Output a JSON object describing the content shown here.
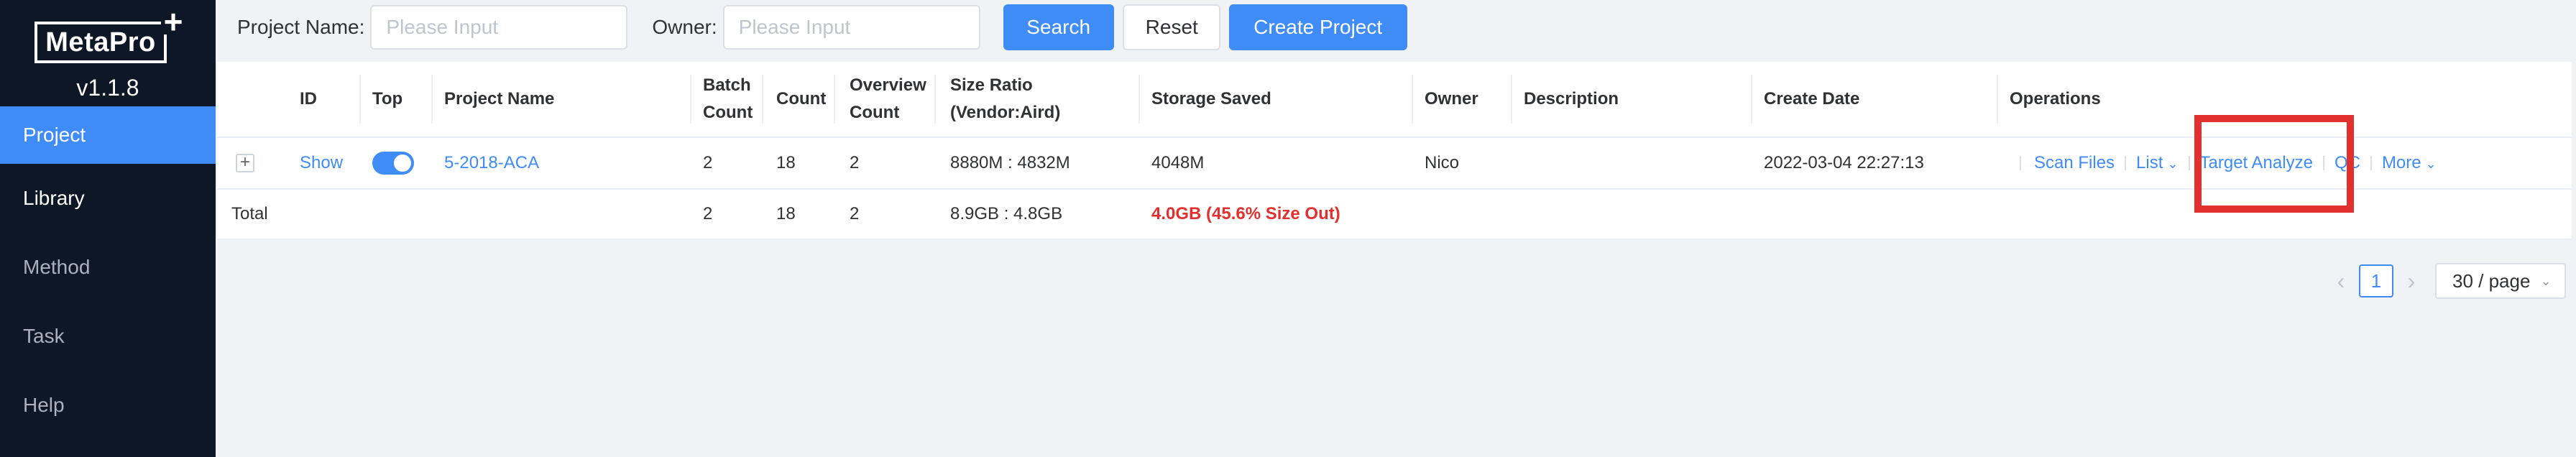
{
  "sidebar": {
    "logo": "MetaPro",
    "logo_plus": "+",
    "version": "v1.1.8",
    "items": [
      {
        "label": "Project"
      },
      {
        "label": "Library"
      },
      {
        "label": "Method"
      },
      {
        "label": "Task"
      },
      {
        "label": "Help"
      }
    ]
  },
  "search": {
    "project_name_label": "Project Name:",
    "project_name_placeholder": "Please Input",
    "owner_label": "Owner:",
    "owner_placeholder": "Please Input",
    "search_btn": "Search",
    "reset_btn": "Reset",
    "create_btn": "Create Project"
  },
  "table": {
    "headers": {
      "id": "ID",
      "top": "Top",
      "project_name": "Project Name",
      "batch_count_1": "Batch",
      "batch_count_2": "Count",
      "count": "Count",
      "overview_1": "Overview",
      "overview_2": "Count",
      "size_ratio_1": "Size Ratio",
      "size_ratio_2": "(Vendor:Aird)",
      "storage_saved": "Storage Saved",
      "owner": "Owner",
      "description": "Description",
      "create_date": "Create Date",
      "operations": "Operations"
    },
    "row": {
      "expand": "+",
      "id": "Show",
      "top_enabled": true,
      "project_name": "5-2018-ACA",
      "batch_count": "2",
      "count": "18",
      "overview_count": "2",
      "size_ratio": "8880M : 4832M",
      "storage_saved": "4048M",
      "owner": "Nico",
      "description": "",
      "create_date": "2022-03-04 22:27:13",
      "ops": {
        "scan_files": "Scan Files",
        "list": "List",
        "target_analyze": "Target Analyze",
        "qc": "QC",
        "more": "More"
      }
    },
    "total": {
      "label": "Total",
      "batch_count": "2",
      "count": "18",
      "overview_count": "2",
      "size_ratio": "8.9GB : 4.8GB",
      "storage_saved": "4.0GB (45.6% Size Out)"
    }
  },
  "pagination": {
    "prev": "‹",
    "current_page": "1",
    "next": "›",
    "page_size": "30 / page"
  },
  "colors": {
    "primary": "#3f8cf7",
    "sidebar_bg": "#0d1726",
    "highlight": "#e2302e"
  }
}
